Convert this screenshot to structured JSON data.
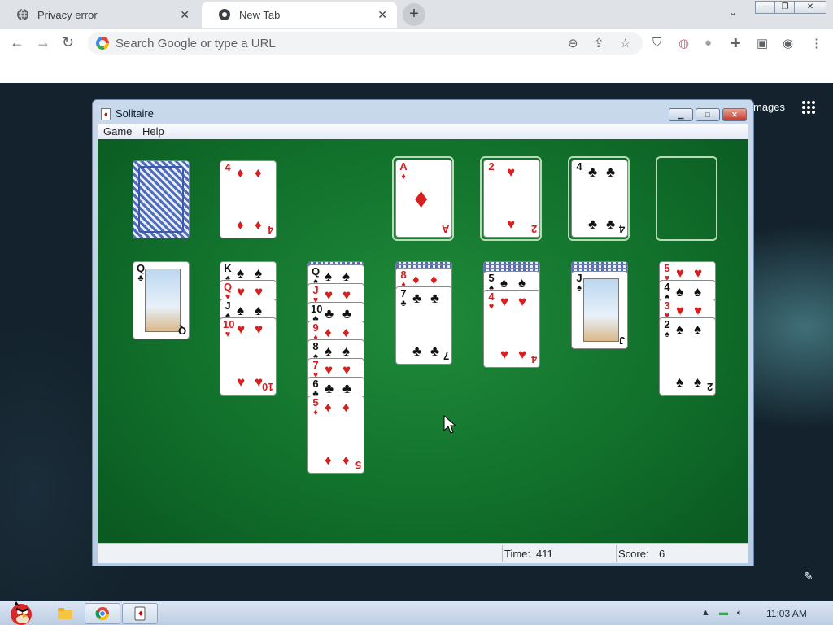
{
  "browser": {
    "tabs": [
      {
        "title": "Privacy error",
        "close": "✕"
      },
      {
        "title": "New Tab",
        "close": "✕"
      }
    ],
    "new_tab": "+",
    "tab_dropdown": "⌄",
    "window_controls": {
      "minimize": "—",
      "restore": "❐",
      "close": "✕"
    },
    "omnibox_placeholder": "Search Google or type a URL"
  },
  "newtab_page": {
    "images_link": "mages"
  },
  "solitaire": {
    "title": "Solitaire",
    "menu": [
      "Game",
      "Help"
    ],
    "controls": {
      "minimize": "▁",
      "maximize": "□",
      "close": "✕"
    },
    "stock_waste": {
      "waste_rank": "4",
      "waste_suit": "♦"
    },
    "foundations": [
      {
        "rank": "A",
        "suit": "♦"
      },
      {
        "rank": "2",
        "suit": "♥"
      },
      {
        "rank": "4",
        "suit": "♣"
      },
      {
        "rank": "",
        "suit": ""
      }
    ],
    "tableau": [
      {
        "cards": [
          {
            "rank": "Q",
            "suit": "♣"
          }
        ]
      },
      {
        "cards": [
          {
            "rank": "K",
            "suit": "♠"
          },
          {
            "rank": "Q",
            "suit": "♥"
          },
          {
            "rank": "J",
            "suit": "♠"
          },
          {
            "rank": "10",
            "suit": "♥"
          }
        ]
      },
      {
        "cards": [
          {
            "rank": "Q",
            "suit": "♠"
          },
          {
            "rank": "J",
            "suit": "♥"
          },
          {
            "rank": "10",
            "suit": "♣"
          },
          {
            "rank": "9",
            "suit": "♦"
          },
          {
            "rank": "8",
            "suit": "♠"
          },
          {
            "rank": "7",
            "suit": "♥"
          },
          {
            "rank": "6",
            "suit": "♣"
          },
          {
            "rank": "5",
            "suit": "♦"
          }
        ]
      },
      {
        "cards": [
          {
            "rank": "8",
            "suit": "♦"
          },
          {
            "rank": "7",
            "suit": "♣"
          }
        ]
      },
      {
        "cards": [
          {
            "rank": "5",
            "suit": "♠"
          },
          {
            "rank": "4",
            "suit": "♥"
          }
        ]
      },
      {
        "cards": [
          {
            "rank": "J",
            "suit": "♠"
          }
        ]
      },
      {
        "cards": [
          {
            "rank": "5",
            "suit": "♥"
          },
          {
            "rank": "4",
            "suit": "♠"
          },
          {
            "rank": "3",
            "suit": "♥"
          },
          {
            "rank": "2",
            "suit": "♠"
          }
        ]
      }
    ],
    "status": {
      "time_label": "Time:",
      "time_value": "411",
      "score_label": "Score:",
      "score_value": "6"
    }
  },
  "taskbar": {
    "clock": "11:03 AM"
  }
}
